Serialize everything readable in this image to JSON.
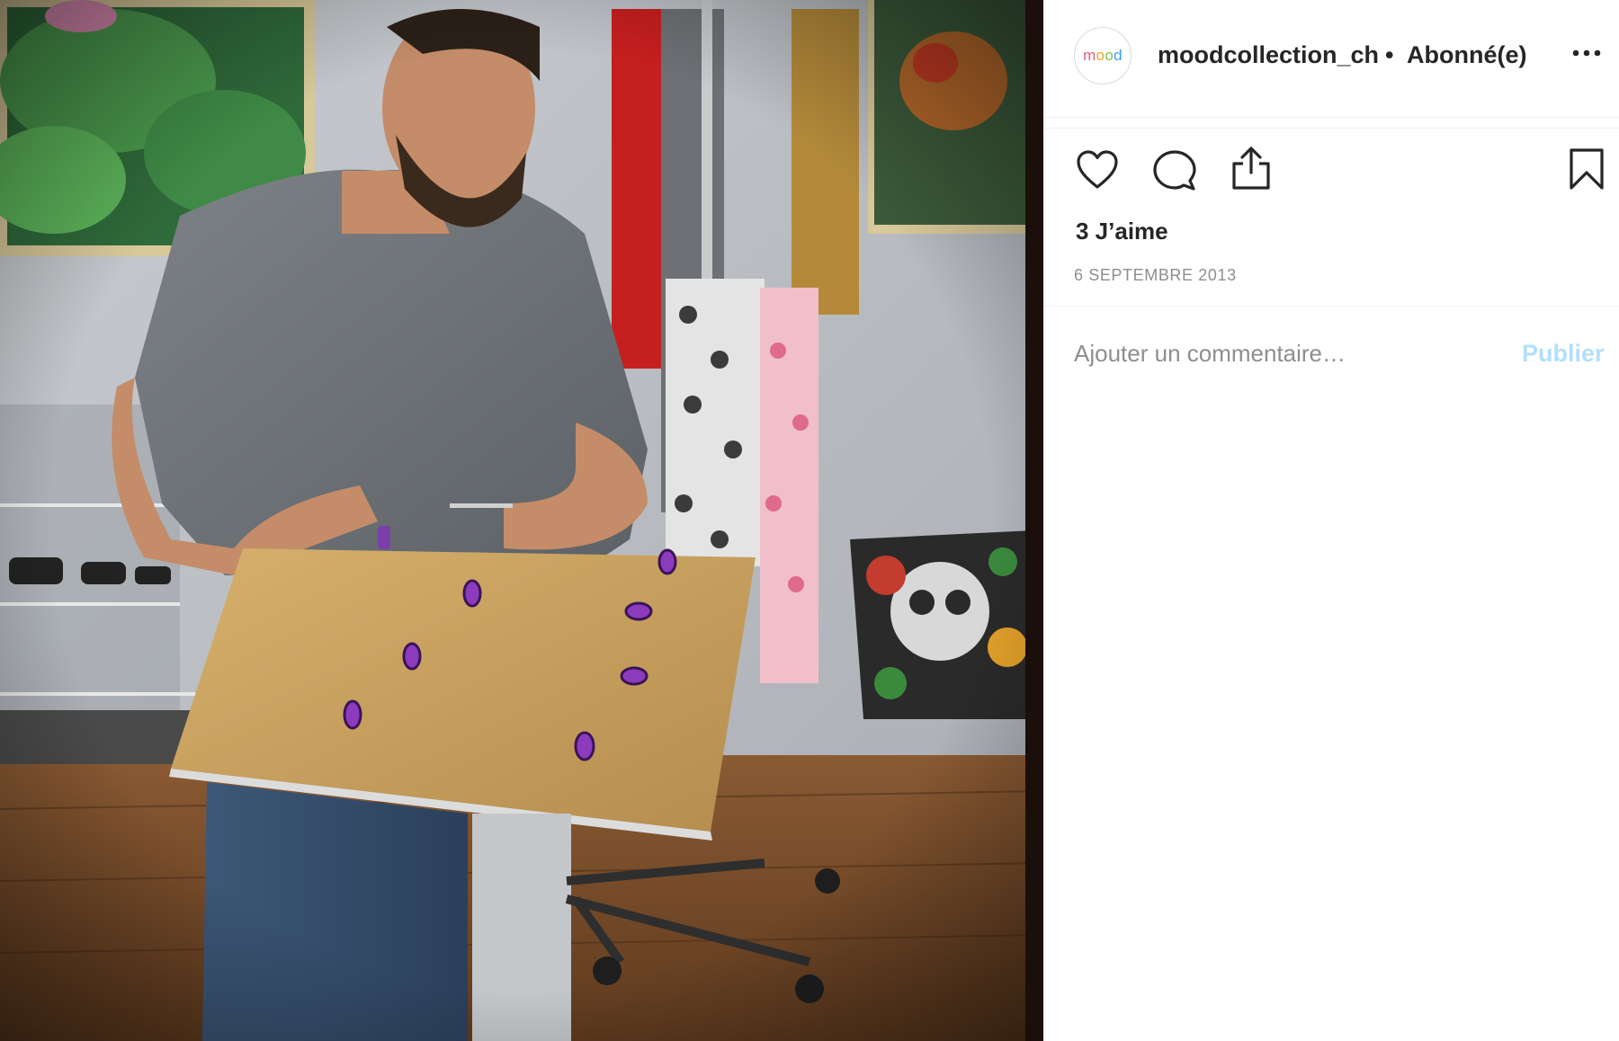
{
  "post": {
    "photo_description": "",
    "image_alt": ""
  },
  "header": {
    "avatar_letters": [
      "m",
      "o",
      "o",
      "d"
    ],
    "username": "moodcollection_ch",
    "separator": "•",
    "follow_status": "Abonné(e)",
    "more_icon": "more-horizontal-icon"
  },
  "actions": {
    "like_icon": "heart-icon",
    "comment_icon": "comment-bubble-icon",
    "share_icon": "share-upload-icon",
    "save_icon": "bookmark-icon"
  },
  "likes": "3 J’aime",
  "date": "6 septembre 2013",
  "comment": {
    "placeholder": "Ajouter un commentaire…",
    "value": "",
    "publish_label": "Publier"
  },
  "colors": {
    "publish_disabled": "#b2dffc",
    "text": "#262626",
    "muted": "#8e8e8e",
    "divider": "#efefef"
  }
}
